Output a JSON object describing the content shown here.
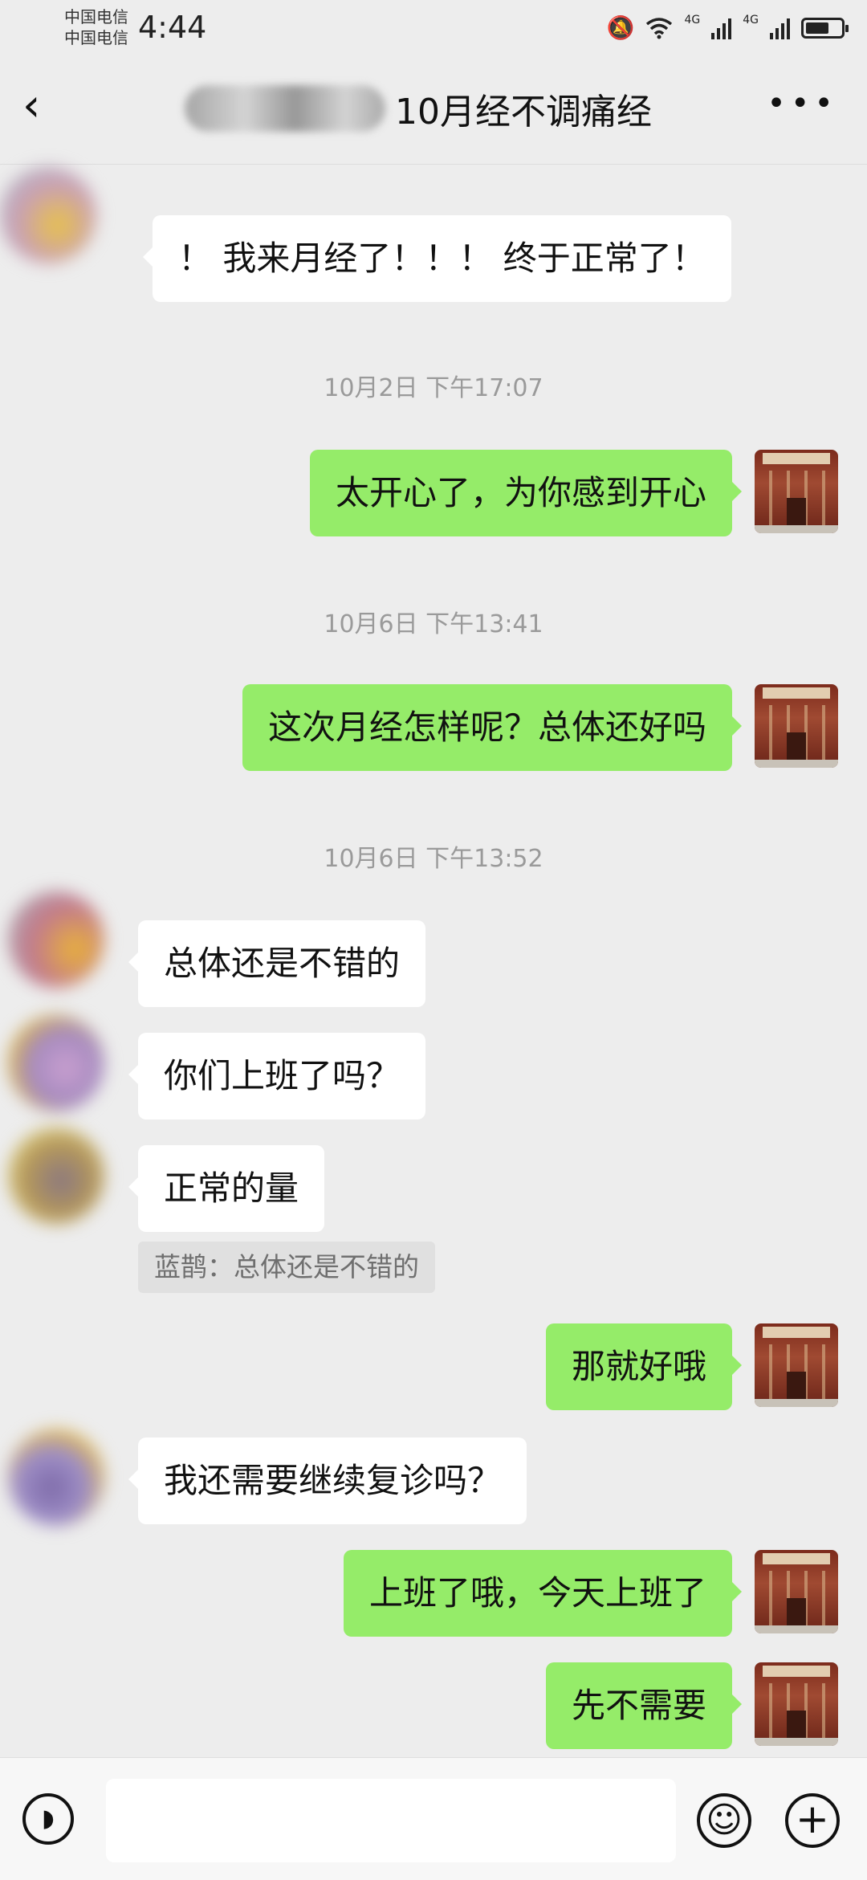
{
  "status_bar": {
    "carrier_1": "中国电信",
    "carrier_2": "中国电信",
    "time": "4:44",
    "network_1": "4G",
    "network_2": "4G",
    "icons": [
      "mute-bell-icon",
      "wifi-icon",
      "signal-icon",
      "signal-icon",
      "battery-icon"
    ]
  },
  "header": {
    "title": "10月经不调痛经",
    "back_icon": "chevron-left-icon",
    "more_icon": "more-dots-icon"
  },
  "messages": [
    {
      "side": "left",
      "text": "！ 我来月经了！！！ 终于正常了！"
    },
    {
      "side": "time",
      "text": "10月2日 下午17:07"
    },
    {
      "side": "right",
      "text": "太开心了，为你感到开心"
    },
    {
      "side": "time",
      "text": "10月6日 下午13:41"
    },
    {
      "side": "right",
      "text": "这次月经怎样呢？总体还好吗"
    },
    {
      "side": "time",
      "text": "10月6日 下午13:52"
    },
    {
      "side": "left",
      "text": "总体还是不错的"
    },
    {
      "side": "left",
      "text": "你们上班了吗？"
    },
    {
      "side": "left",
      "text": "正常的量"
    },
    {
      "side": "quote",
      "text": "蓝鹊：总体还是不错的"
    },
    {
      "side": "right",
      "text": "那就好哦"
    },
    {
      "side": "left",
      "text": "我还需要继续复诊吗？"
    },
    {
      "side": "right",
      "text": "上班了哦，今天上班了"
    },
    {
      "side": "right",
      "text": "先不需要"
    }
  ],
  "input_bar": {
    "voice_icon": "voice-icon",
    "input_value": "",
    "emoji_icon": "emoji-icon",
    "add_icon": "plus-icon"
  },
  "colors": {
    "background": "#ededed",
    "self_bubble": "#95ec69",
    "other_bubble": "#ffffff",
    "timestamp": "#9a9a9a"
  }
}
